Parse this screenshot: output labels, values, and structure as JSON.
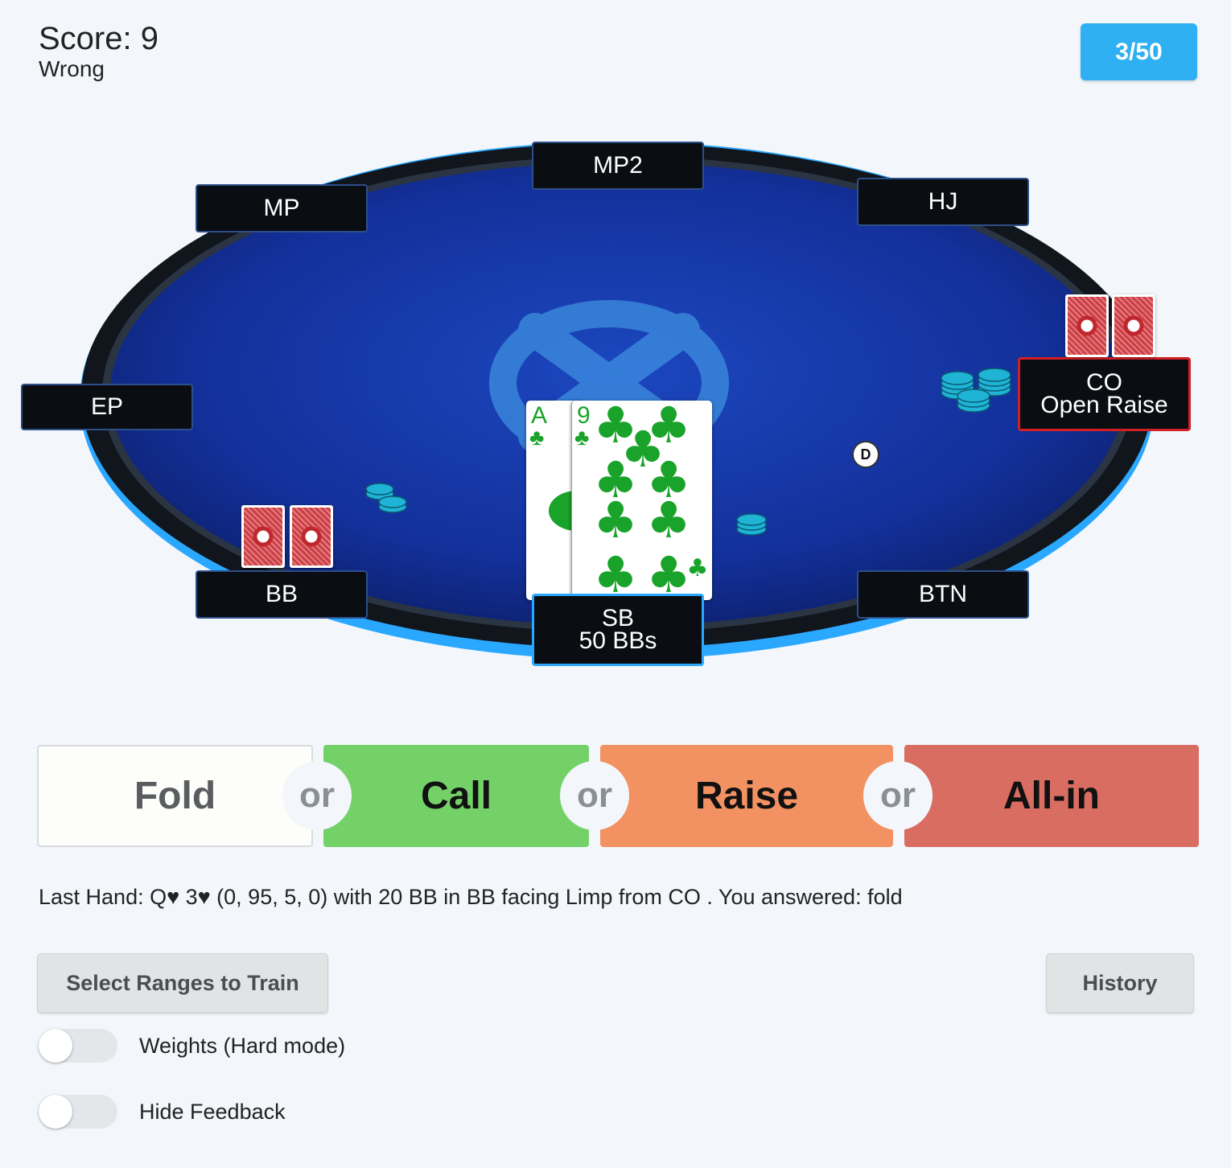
{
  "header": {
    "score": "Score: 9",
    "status": "Wrong",
    "counter": "3/50"
  },
  "table": {
    "seats": {
      "mp2": "MP2",
      "mp": "MP",
      "hj": "HJ",
      "ep": "EP",
      "co": "CO",
      "co_action": "Open Raise",
      "bb": "BB",
      "btn": "BTN",
      "sb": "SB",
      "sb_stack": "50 BBs"
    },
    "dealer_button": "D",
    "hero_cards": [
      {
        "rank": "A",
        "suit": "♣"
      },
      {
        "rank": "9",
        "suit": "♣"
      }
    ],
    "colors": {
      "felt": "#14309a",
      "rim": "#2aa7ff",
      "club": "#1aa32a"
    }
  },
  "actions": {
    "fold": "Fold",
    "call": "Call",
    "raise": "Raise",
    "allin": "All-in",
    "or": "or"
  },
  "last_hand": "Last Hand: Q♥ 3♥ (0, 95, 5, 0) with 20 BB in BB facing Limp from CO . You answered: fold",
  "buttons": {
    "select_ranges": "Select Ranges to Train",
    "history": "History"
  },
  "toggles": {
    "weights": "Weights (Hard mode)",
    "hide_feedback": "Hide Feedback"
  }
}
